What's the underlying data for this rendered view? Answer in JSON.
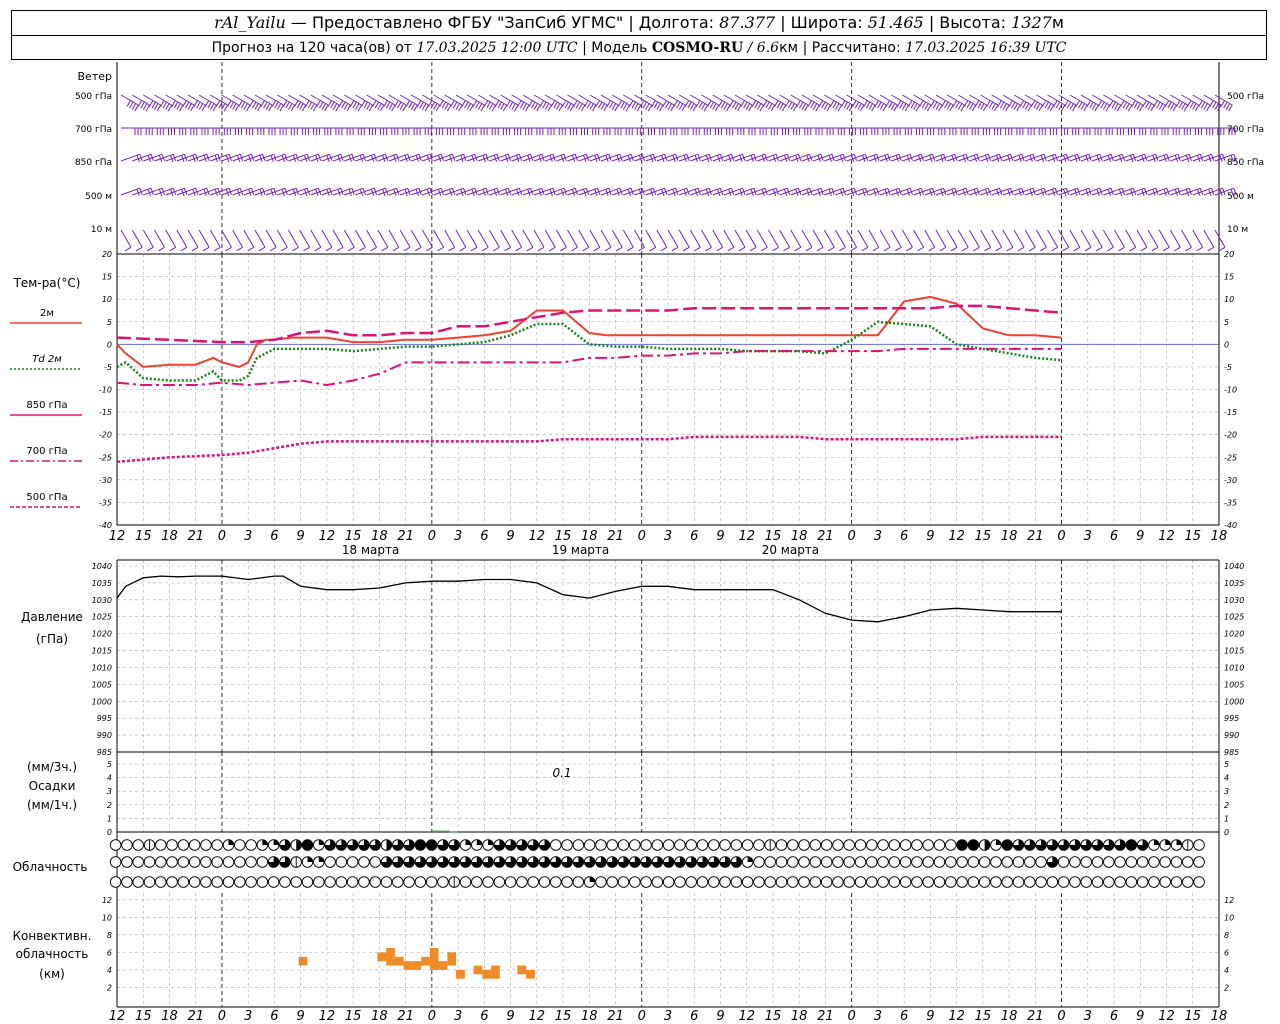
{
  "header": {
    "station": "rAl_Yailu",
    "provider": "— Предоставлено ФГБУ \"ЗапСиб УГМС\" |",
    "lon_label": "Долгота:",
    "lon": "87.377",
    "lat_label": "| Широта:",
    "lat": "51.465",
    "alt_label": "| Высота:",
    "alt": "1327",
    "alt_unit": "м",
    "forecast_label": "Прогноз на 120 часа(ов) от",
    "forecast_start": "17.03.2025 12:00 UTC",
    "model_label": "| Модель",
    "model": "COSMO-RU",
    "resolution": "/ 6.6",
    "resolution_unit": "км",
    "calc_label": "| Рассчитано:",
    "calc_time": "17.03.2025 16:39 UTC"
  },
  "wind_panel": {
    "title": "Ветер",
    "levels": [
      "500 гПа",
      "700 гПа",
      "850 гПа",
      "500 м",
      "10 м"
    ]
  },
  "temp_panel": {
    "title": "Тем-ра(°C)",
    "legend": [
      "2м",
      "Td 2м",
      "850 гПа",
      "700 гПа",
      "500 гПа"
    ]
  },
  "pressure_panel": {
    "title": "Давление",
    "unit": "(гПа)"
  },
  "precip_panel": {
    "unit_top": "(мм/3ч.)",
    "title": "Осадки",
    "unit_bottom": "(мм/1ч.)",
    "annotation": "0.1"
  },
  "cloud_panel": {
    "title": "Облачность"
  },
  "conv_panel": {
    "title_line1": "Конвективн.",
    "title_line2": "облачность",
    "unit": "(км)"
  },
  "colors": {
    "t2m": "#f04030",
    "td2m": "#118811",
    "t850": "#dd1177",
    "t700": "#dd1177",
    "t500": "#dd1177",
    "wind": "#7722bb",
    "conv": "#f08c28",
    "precip": "#22aa22"
  },
  "chart_data": [
    {
      "type": "line",
      "name": "temperature",
      "x_hours": [
        0,
        3,
        6,
        9,
        12,
        15,
        18,
        21,
        24,
        27,
        30,
        33,
        36,
        39,
        42,
        45,
        48,
        51,
        54,
        57,
        60,
        63,
        66,
        69,
        72,
        75,
        78,
        81,
        84,
        87,
        90,
        93,
        96,
        99,
        102,
        105,
        108,
        111,
        114,
        117,
        120,
        123,
        126
      ],
      "tick_labels": [
        "12",
        "15",
        "18",
        "21",
        "0",
        "3",
        "6",
        "9",
        "12",
        "15",
        "18",
        "21",
        "0",
        "3",
        "6",
        "9",
        "12",
        "15",
        "18",
        "21",
        "0",
        "3",
        "6",
        "9",
        "12",
        "15",
        "18",
        "21",
        "0",
        "3",
        "6",
        "9",
        "12",
        "15",
        "18",
        "21",
        "0",
        "3",
        "6",
        "9",
        "12",
        "15",
        "18"
      ],
      "date_labels": [
        {
          "text": "18 марта",
          "hour": 24
        },
        {
          "text": "19 марта",
          "hour": 48
        },
        {
          "text": "20 марта",
          "hour": 72
        }
      ],
      "ylim": [
        -40,
        20
      ],
      "yticks": [
        20,
        15,
        10,
        5,
        0,
        -5,
        -10,
        -15,
        -20,
        -25,
        -30,
        -35,
        -40
      ],
      "grid": true,
      "series": [
        {
          "name": "2м",
          "style": "solid",
          "x": [
            0,
            1,
            3,
            6,
            9,
            11,
            12,
            14,
            15,
            16,
            17,
            18,
            20,
            24,
            27,
            30,
            33,
            36,
            39,
            42,
            45,
            48,
            51,
            54,
            56,
            58,
            60,
            62,
            63,
            64,
            66,
            69,
            72,
            75,
            78,
            80,
            82,
            84,
            86,
            87,
            90,
            93,
            96,
            99,
            102,
            105,
            108
          ],
          "y": [
            0,
            -2,
            -5,
            -4.5,
            -4.5,
            -3,
            -4,
            -5,
            -4,
            0,
            1,
            1,
            1.5,
            1.5,
            0.5,
            0.5,
            1,
            1,
            1.5,
            2,
            3,
            7.5,
            7.5,
            2.5,
            2,
            2,
            2,
            2,
            2,
            2,
            2,
            2,
            2,
            2,
            2,
            2,
            2,
            2,
            2,
            2,
            9.5,
            10.5,
            9,
            3.5,
            2,
            2,
            1.5
          ]
        },
        {
          "name": "Td 2м",
          "style": "dotted",
          "x": [
            0,
            1,
            3,
            6,
            9,
            11,
            12,
            14,
            15,
            16,
            18,
            21,
            24,
            27,
            30,
            33,
            36,
            39,
            42,
            45,
            48,
            51,
            54,
            57,
            60,
            63,
            66,
            69,
            72,
            75,
            78,
            81,
            84,
            87,
            90,
            93,
            96,
            99,
            102,
            105,
            108
          ],
          "y": [
            -5,
            -4,
            -7.5,
            -8,
            -8,
            -6,
            -8,
            -8,
            -7,
            -3,
            -1,
            -1,
            -1,
            -1.5,
            -1,
            -0.5,
            -0.5,
            0,
            0.5,
            2,
            4.5,
            4.5,
            0,
            -0.5,
            -0.5,
            -1,
            -1,
            -1,
            -1.5,
            -1.5,
            -1.5,
            -2,
            1,
            5,
            4.5,
            4,
            0,
            -1,
            -2,
            -3,
            -3.5
          ]
        },
        {
          "name": "850 гПа",
          "style": "longdash",
          "x": [
            0,
            6,
            12,
            15,
            18,
            21,
            24,
            27,
            30,
            33,
            36,
            39,
            42,
            45,
            48,
            51,
            54,
            57,
            60,
            63,
            66,
            69,
            72,
            75,
            78,
            81,
            84,
            87,
            90,
            93,
            96,
            99,
            102,
            105,
            108
          ],
          "y": [
            1.5,
            1,
            0.5,
            0.5,
            1,
            2.5,
            3,
            2,
            2,
            2.5,
            2.5,
            4,
            4,
            5,
            6,
            7,
            7.5,
            7.5,
            7.5,
            7.5,
            8,
            8,
            8,
            8,
            8,
            8,
            8,
            8,
            8,
            8,
            8.5,
            8.5,
            8,
            7.5,
            7
          ]
        },
        {
          "name": "700 гПа",
          "style": "dashdot",
          "x": [
            0,
            3,
            6,
            9,
            12,
            15,
            18,
            21,
            24,
            27,
            30,
            33,
            36,
            39,
            42,
            45,
            48,
            51,
            54,
            57,
            60,
            63,
            66,
            69,
            72,
            75,
            78,
            81,
            84,
            87,
            90,
            93,
            96,
            99,
            102,
            105,
            108
          ],
          "y": [
            -8.5,
            -9,
            -9,
            -9,
            -8.5,
            -9,
            -8.5,
            -8,
            -9,
            -8,
            -6.5,
            -4,
            -4,
            -4,
            -4,
            -4,
            -4,
            -4,
            -3,
            -3,
            -2.5,
            -2.5,
            -2,
            -2,
            -1.5,
            -1.5,
            -1.5,
            -1.5,
            -1.5,
            -1.5,
            -1,
            -1,
            -1,
            -1,
            -1,
            -1,
            -1
          ]
        },
        {
          "name": "500 гПа",
          "style": "shortdash",
          "x": [
            0,
            6,
            12,
            15,
            18,
            21,
            24,
            27,
            30,
            33,
            36,
            39,
            42,
            45,
            48,
            51,
            54,
            57,
            60,
            63,
            66,
            69,
            72,
            75,
            78,
            81,
            84,
            87,
            90,
            93,
            96,
            99,
            102,
            105,
            108
          ],
          "y": [
            -26,
            -25,
            -24.5,
            -24,
            -23,
            -22,
            -21.5,
            -21.5,
            -21.5,
            -21.5,
            -21.5,
            -21.5,
            -21.5,
            -21.5,
            -21.5,
            -21,
            -21,
            -21,
            -21,
            -21,
            -20.5,
            -20.5,
            -20.5,
            -20.5,
            -20.5,
            -21,
            -21,
            -21,
            -21,
            -21,
            -21,
            -20.5,
            -20.5,
            -20.5,
            -20.5
          ]
        }
      ]
    },
    {
      "type": "line",
      "name": "pressure",
      "ylim": [
        985,
        1040
      ],
      "yticks": [
        1040,
        1035,
        1030,
        1025,
        1020,
        1015,
        1010,
        1005,
        1000,
        995,
        990,
        985
      ],
      "x": [
        0,
        1,
        3,
        5,
        7,
        9,
        12,
        15,
        18,
        19,
        21,
        24,
        27,
        30,
        33,
        36,
        39,
        42,
        45,
        48,
        51,
        54,
        57,
        60,
        63,
        66,
        69,
        72,
        75,
        78,
        81,
        84,
        87,
        90,
        93,
        96,
        99,
        102,
        105,
        108
      ],
      "y": [
        1030.5,
        1034,
        1036.5,
        1037,
        1036.8,
        1037,
        1037,
        1036,
        1037,
        1037,
        1034,
        1033,
        1033,
        1033.5,
        1035,
        1035.5,
        1035.5,
        1036,
        1036,
        1035,
        1031.5,
        1030.5,
        1032.5,
        1034,
        1034,
        1033,
        1033,
        1033,
        1033,
        1030,
        1026,
        1024,
        1023.5,
        1025,
        1027,
        1027.5,
        1027,
        1026.5,
        1026.5,
        1026.5
      ]
    },
    {
      "type": "bar",
      "name": "precipitation",
      "ylim": [
        0,
        5
      ],
      "yticks": [
        5,
        4,
        3,
        2,
        1,
        0
      ],
      "x": [
        36,
        37,
        38
      ],
      "values": [
        0.1,
        0.1,
        0.05
      ]
    },
    {
      "type": "table",
      "name": "cloudiness",
      "rows": [
        {
          "name": "upper",
          "codes": "0001000000200224352444443445544222444440000000000000000000100000000000000005532544444444445422210"
        },
        {
          "name": "middle",
          "codes": "0000000000000044122000004444444444444444444444444444444420000000000000000000000000040000000000000"
        },
        {
          "name": "lower",
          "codes": "0000000000000000000000000000001000000000002000000000000000000000000000000000000000000000000000000"
        }
      ]
    },
    {
      "type": "bar",
      "name": "convective_cloud",
      "ylim": [
        0,
        12
      ],
      "yticks": [
        12,
        10,
        8,
        6,
        4,
        2
      ],
      "segments": [
        {
          "x0": 21,
          "x1": 22,
          "y0": 4.5,
          "y1": 5.5
        },
        {
          "x0": 30,
          "x1": 31,
          "y0": 5,
          "y1": 6
        },
        {
          "x0": 31,
          "x1": 32,
          "y0": 4.5,
          "y1": 6.5
        },
        {
          "x0": 32,
          "x1": 33,
          "y0": 4.5,
          "y1": 5.5
        },
        {
          "x0": 33,
          "x1": 34,
          "y0": 4,
          "y1": 5
        },
        {
          "x0": 34,
          "x1": 35,
          "y0": 4,
          "y1": 5
        },
        {
          "x0": 35,
          "x1": 36,
          "y0": 4.5,
          "y1": 5.5
        },
        {
          "x0": 36,
          "x1": 37,
          "y0": 4,
          "y1": 6.5
        },
        {
          "x0": 37,
          "x1": 38,
          "y0": 4,
          "y1": 5
        },
        {
          "x0": 38,
          "x1": 39,
          "y0": 4.5,
          "y1": 6
        },
        {
          "x0": 39,
          "x1": 40,
          "y0": 3,
          "y1": 4
        },
        {
          "x0": 41,
          "x1": 42,
          "y0": 3.5,
          "y1": 4.5
        },
        {
          "x0": 42,
          "x1": 43,
          "y0": 3,
          "y1": 4
        },
        {
          "x0": 43,
          "x1": 44,
          "y0": 3,
          "y1": 4.5
        },
        {
          "x0": 46,
          "x1": 47,
          "y0": 3.5,
          "y1": 4.5
        },
        {
          "x0": 47,
          "x1": 48,
          "y0": 3,
          "y1": 4
        }
      ]
    },
    {
      "type": "table",
      "name": "wind",
      "levels": [
        "500 гПа",
        "700 гПа",
        "850 гПа",
        "500 м",
        "10 м"
      ],
      "directions_deg": [
        300,
        270,
        250,
        250,
        330
      ],
      "speeds_kt": [
        35,
        30,
        20,
        20,
        10
      ]
    }
  ]
}
